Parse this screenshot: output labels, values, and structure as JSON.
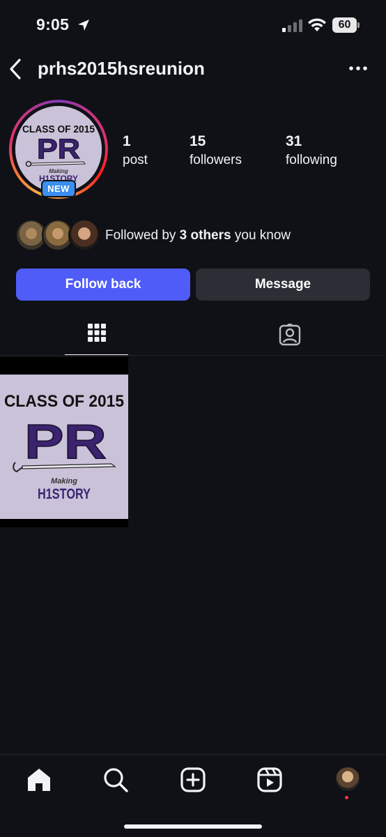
{
  "status_bar": {
    "time": "9:05",
    "battery": "60"
  },
  "header": {
    "username": "prhs2015hsreunion"
  },
  "profile": {
    "avatar_badge": "NEW",
    "logo": {
      "line1": "CLASS OF 2015",
      "initials": "PR",
      "tag1": "Making",
      "tag2": "H1STORY"
    }
  },
  "stats": [
    {
      "value": "1",
      "label": "post"
    },
    {
      "value": "15",
      "label": "followers"
    },
    {
      "value": "31",
      "label": "following"
    }
  ],
  "followed_by": {
    "prefix": "Followed by ",
    "bold": "3 others",
    "suffix": " you know"
  },
  "buttons": {
    "follow": "Follow back",
    "message": "Message"
  },
  "tabs": [
    "grid-icon",
    "tagged-icon"
  ],
  "post_logo": {
    "line1": "CLASS OF 2015",
    "initials": "PR",
    "tag1": "Making",
    "tag2": "H1STORY"
  },
  "nav": [
    "home-icon",
    "search-icon",
    "create-icon",
    "reels-icon",
    "profile-avatar"
  ],
  "colors": {
    "background": "#0f1116",
    "follow_button": "#4f5cf8",
    "message_button": "#2b2e35",
    "logo_purple": "#3b2370",
    "badge_blue": "#3a8ff0"
  }
}
